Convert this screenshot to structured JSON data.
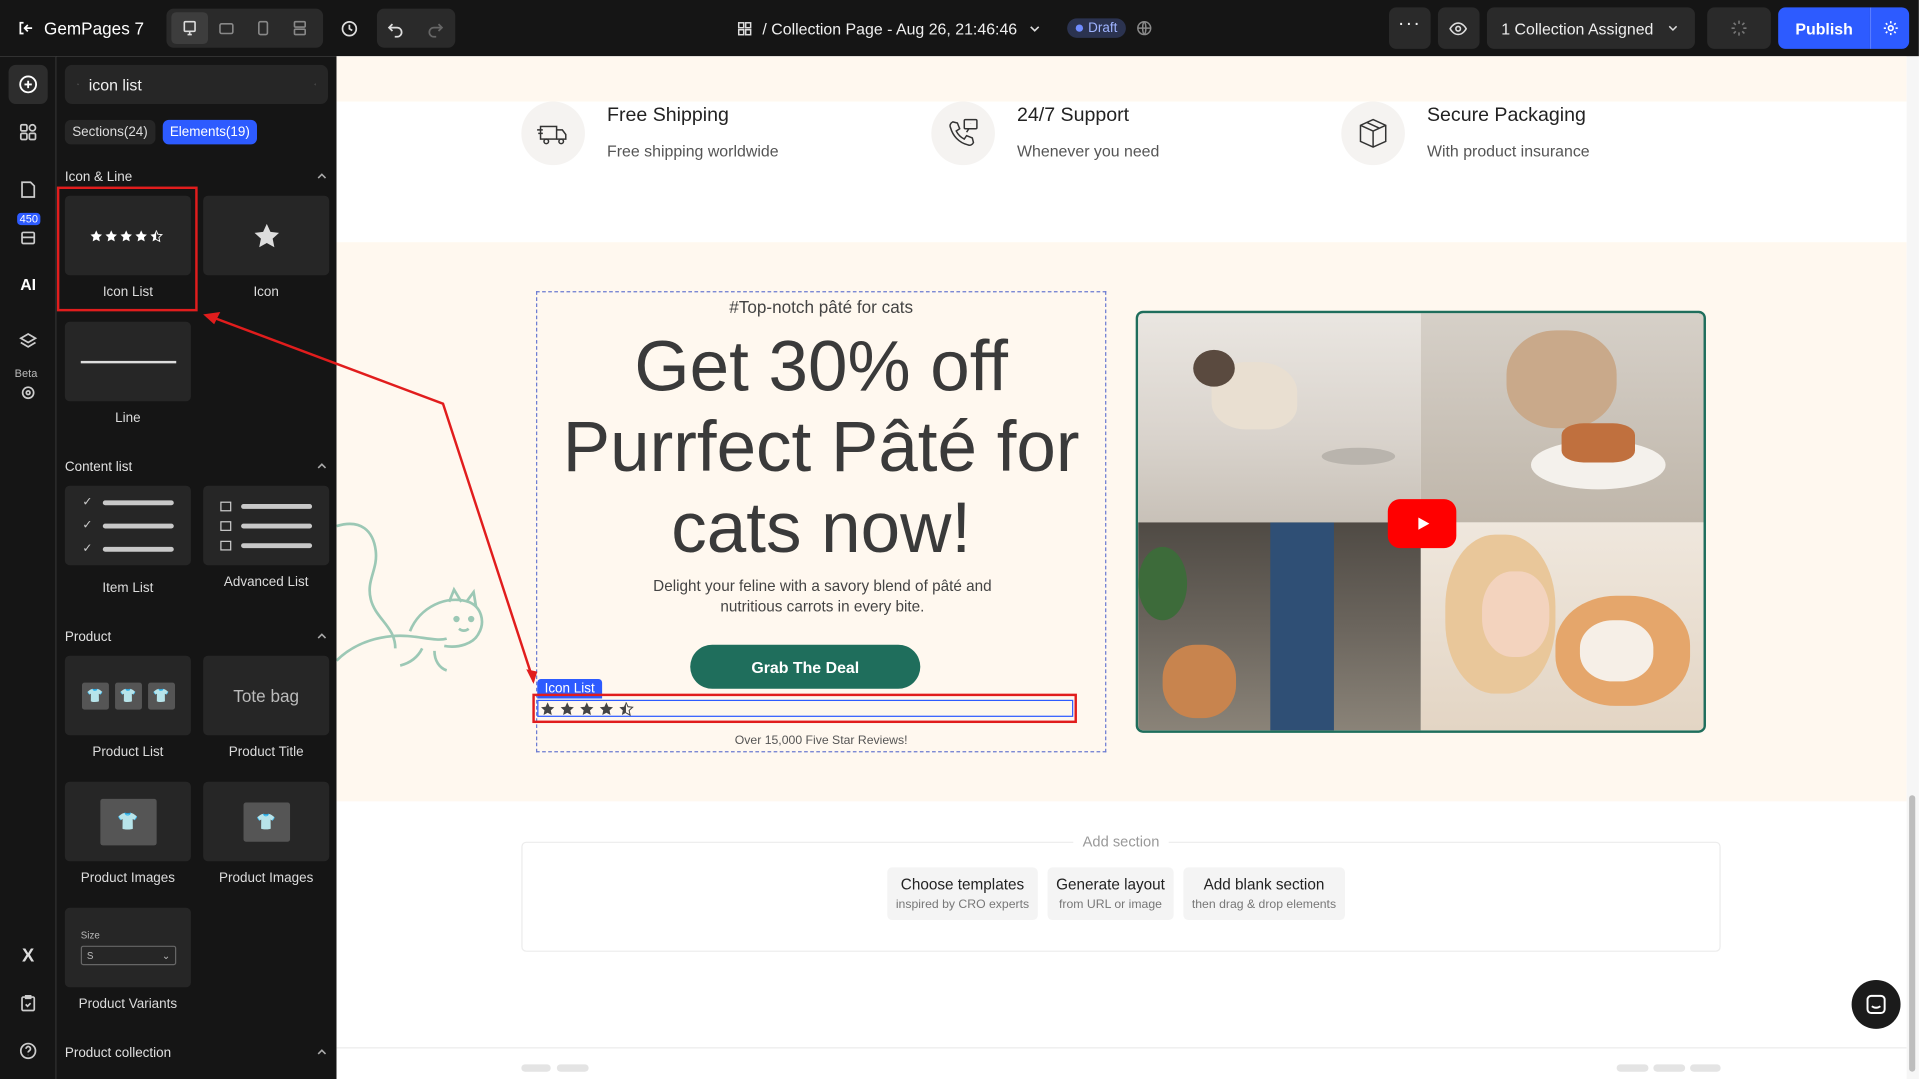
{
  "topbar": {
    "app_name": "GemPages 7",
    "page_title": "/ Collection Page - Aug 26, 21:46:46",
    "draft_label": "Draft",
    "assigned_label": "1 Collection Assigned",
    "publish_label": "Publish"
  },
  "rail": {
    "badge_count": "450",
    "beta_label": "Beta",
    "ai_label": "AI"
  },
  "panel": {
    "search_value": "icon list",
    "tabs": [
      {
        "label": "Sections(24)"
      },
      {
        "label": "Elements(19)"
      }
    ],
    "categories": {
      "icon_line": "Icon & Line",
      "content_list": "Content list",
      "product": "Product",
      "product_collection": "Product collection"
    },
    "tiles": {
      "icon_list": "Icon List",
      "icon": "Icon",
      "line": "Line",
      "item_list": "Item List",
      "advanced_list": "Advanced List",
      "product_list": "Product List",
      "product_title": "Product Title",
      "product_title_preview": "Tote bag",
      "product_images_1": "Product Images",
      "product_images_2": "Product Images",
      "product_variants": "Product Variants",
      "size_label": "Size",
      "size_value": "S"
    }
  },
  "canvas": {
    "features": [
      {
        "title": "Free Shipping",
        "subtitle": "Free shipping worldwide",
        "icon": "truck-icon"
      },
      {
        "title": "24/7 Support",
        "subtitle": "Whenever you need",
        "icon": "phone-support-icon"
      },
      {
        "title": "Secure Packaging",
        "subtitle": "With product insurance",
        "icon": "box-icon"
      }
    ],
    "hero": {
      "eyebrow": "#Top-notch pâté for cats",
      "headline_1": "Get 30% off",
      "headline_2": "Purrfect Pâté for",
      "headline_3": "cats now!",
      "subcopy": "Delight your feline with a savory blend of pâté and nutritious carrots in every bite.",
      "cta_label": "Grab The Deal",
      "icon_list_tag": "Icon List",
      "reviews": "Over 15,000 Five Star Reviews!",
      "rating": 4.5
    },
    "add_section": {
      "title": "Add section",
      "buttons": [
        {
          "title": "Choose templates",
          "subtitle": "inspired by CRO experts"
        },
        {
          "title": "Generate layout",
          "subtitle": "from URL or image"
        },
        {
          "title": "Add blank section",
          "subtitle": "then drag & drop elements"
        }
      ]
    }
  },
  "colors": {
    "accent": "#2d5bff",
    "brand_green": "#1f6e5c",
    "cream": "#fff8ef",
    "annotation_red": "#e11d1d"
  }
}
